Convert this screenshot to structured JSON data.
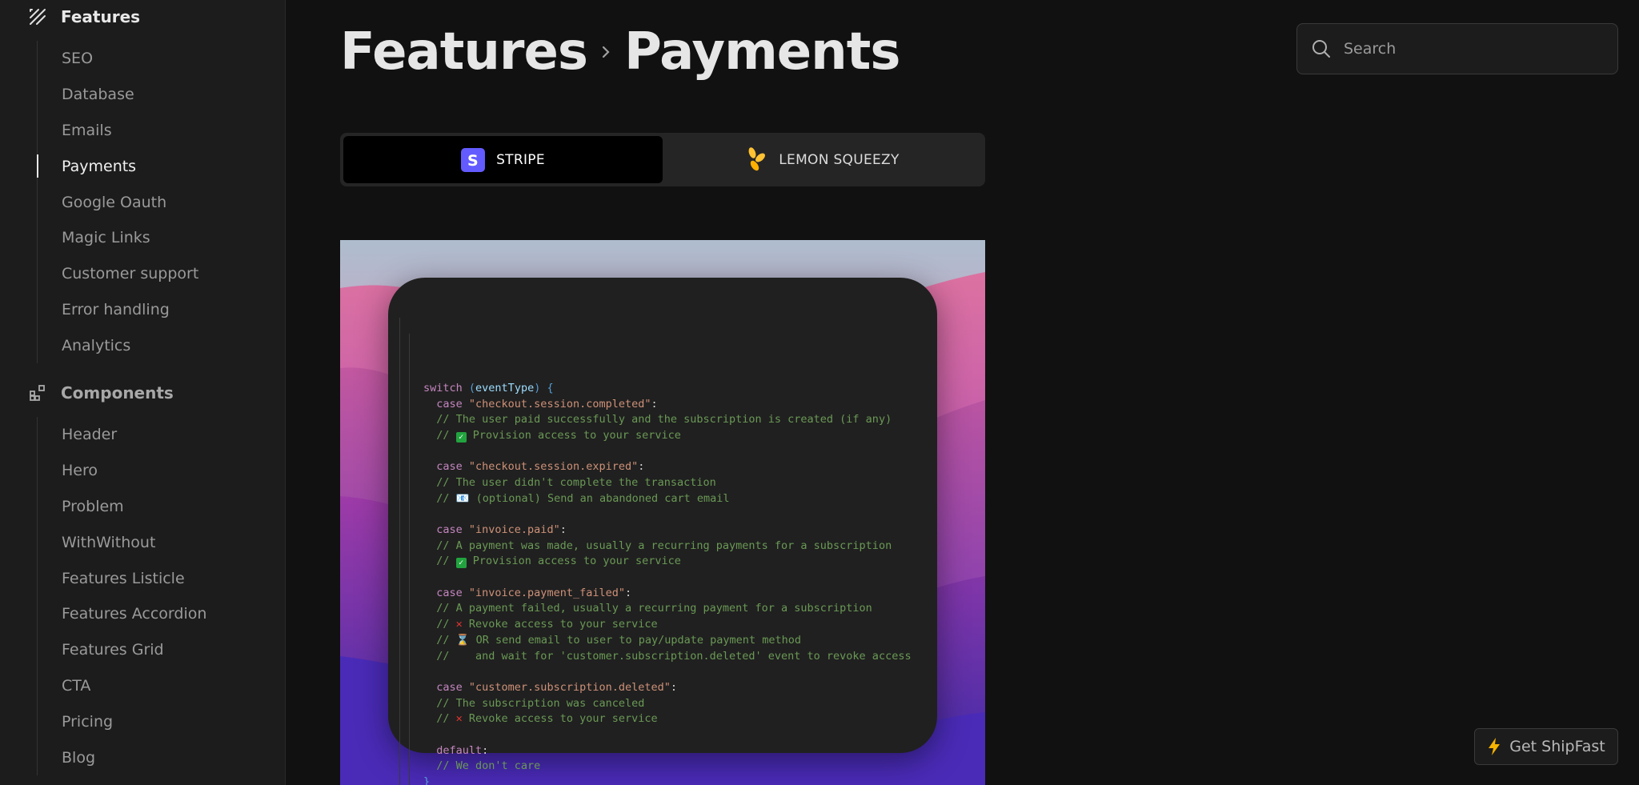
{
  "sidebar": {
    "features_header": "Features",
    "features_items": [
      "SEO",
      "Database",
      "Emails",
      "Payments",
      "Google Oauth",
      "Magic Links",
      "Customer support",
      "Error handling",
      "Analytics"
    ],
    "active_item": "Payments",
    "components_header": "Components",
    "components_items": [
      "Header",
      "Hero",
      "Problem",
      "WithWithout",
      "Features Listicle",
      "Features Accordion",
      "Features Grid",
      "CTA",
      "Pricing",
      "Blog"
    ]
  },
  "breadcrumb": {
    "parent": "Features",
    "current": "Payments"
  },
  "search": {
    "placeholder": "Search"
  },
  "tabs": [
    {
      "label": "STRIPE",
      "icon": "stripe-logo-icon",
      "active": true
    },
    {
      "label": "LEMON SQUEEZY",
      "icon": "lemon-squeezy-logo-icon",
      "active": false
    }
  ],
  "code_lines": [
    [
      [
        "kw",
        "switch "
      ],
      [
        "pn",
        "("
      ],
      [
        "vr",
        "eventType"
      ],
      [
        "pn",
        ")"
      ],
      [
        "",
        ""
      ],
      [
        "pn",
        " {"
      ]
    ],
    [
      [
        "kw",
        "  case "
      ],
      [
        "st",
        "\"checkout.session.completed\""
      ],
      [
        "",
        ":"
      ]
    ],
    [
      [
        "cm",
        "  // The user paid successfully and the subscription is created (if any)"
      ]
    ],
    [
      [
        "cm",
        "  // "
      ],
      [
        "check",
        ""
      ],
      [
        "cm",
        " Provision access to your service"
      ]
    ],
    [
      [
        "",
        ""
      ]
    ],
    [
      [
        "kw",
        "  case "
      ],
      [
        "st",
        "\"checkout.session.expired\""
      ],
      [
        "",
        ":"
      ]
    ],
    [
      [
        "cm",
        "  // The user didn't complete the transaction"
      ]
    ],
    [
      [
        "cm",
        "  // 📧 (optional) Send an abandoned cart email"
      ]
    ],
    [
      [
        "",
        ""
      ]
    ],
    [
      [
        "kw",
        "  case "
      ],
      [
        "st",
        "\"invoice.paid\""
      ],
      [
        "",
        ":"
      ]
    ],
    [
      [
        "cm",
        "  // A payment was made, usually a recurring payments for a subscription"
      ]
    ],
    [
      [
        "cm",
        "  // "
      ],
      [
        "check",
        ""
      ],
      [
        "cm",
        " Provision access to your service"
      ]
    ],
    [
      [
        "",
        ""
      ]
    ],
    [
      [
        "kw",
        "  case "
      ],
      [
        "st",
        "\"invoice.payment_failed\""
      ],
      [
        "",
        ":"
      ]
    ],
    [
      [
        "cm",
        "  // A payment failed, usually a recurring payment for a subscription"
      ]
    ],
    [
      [
        "cm",
        "  // "
      ],
      [
        "x",
        "✕"
      ],
      [
        "cm",
        " Revoke access to your service"
      ]
    ],
    [
      [
        "cm",
        "  // ⌛ OR send email to user to pay/update payment method"
      ]
    ],
    [
      [
        "cm",
        "  //    and wait for 'customer.subscription.deleted' event to revoke access"
      ]
    ],
    [
      [
        "",
        ""
      ]
    ],
    [
      [
        "kw",
        "  case "
      ],
      [
        "st",
        "\"customer.subscription.deleted\""
      ],
      [
        "",
        ":"
      ]
    ],
    [
      [
        "cm",
        "  // The subscription was canceled"
      ]
    ],
    [
      [
        "cm",
        "  // "
      ],
      [
        "x",
        "✕"
      ],
      [
        "cm",
        " Revoke access to your service"
      ]
    ],
    [
      [
        "",
        ""
      ]
    ],
    [
      [
        "kw",
        "  default"
      ],
      [
        "",
        ":"
      ]
    ],
    [
      [
        "cm",
        "  // We don't care"
      ]
    ],
    [
      [
        "pn",
        "}"
      ]
    ]
  ],
  "cta": {
    "label": "Get ShipFast"
  },
  "colors": {
    "background": "#111111",
    "sidebar": "#1c1c1c",
    "code_card": "#202020",
    "stripe": "#635bff",
    "lemon": "#ffc233",
    "bolt": "#f5b301"
  }
}
